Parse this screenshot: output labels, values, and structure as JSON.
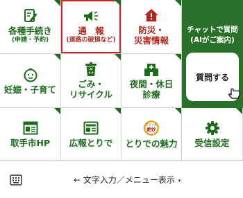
{
  "colors": {
    "brand_green": "#2a6f2a",
    "tile_green": "#1e6b1e",
    "alert_red": "#b3261e",
    "selected_outline": "#c62828"
  },
  "menu": {
    "procedures": {
      "label": "各種手続き",
      "sub": "(申請・予約)",
      "icon": "document-pen-icon"
    },
    "report": {
      "label": "通　報",
      "sub": "(道路の破損など)",
      "icon": "megaphone-icon"
    },
    "disaster": {
      "line1": "防災・",
      "line2": "災害情報",
      "icon": "house-alert-icon"
    },
    "childcare": {
      "label": "妊娠・子育て",
      "icon": "baby-face-icon"
    },
    "recycle": {
      "line1": "ごみ・",
      "line2": "リサイクル",
      "icon": "recycle-bin-icon"
    },
    "night": {
      "line1": "夜間・休日",
      "line2": "診療",
      "icon": "hospital-icon"
    },
    "homepage": {
      "label": "取手市HP",
      "icon": "web-page-icon"
    },
    "newsletter": {
      "label": "広報とりで",
      "icon": "newsletter-icon"
    },
    "charm": {
      "label": "とりでの魅力",
      "icon": "charm-badge-icon",
      "badge_top": "とりでの",
      "badge_text": "絶妙"
    },
    "settings": {
      "label": "受信設定",
      "icon": "gear-icon"
    }
  },
  "chat": {
    "title_line1": "チャットで質問",
    "title_line2": "(AIがご案内)",
    "button_label": "質問する",
    "icon": "pointing-hand-icon"
  },
  "footer": {
    "keyboard_icon": "keyboard-icon",
    "toggle_label": "← 文字入力／メニュー表示",
    "caret": "▾"
  }
}
